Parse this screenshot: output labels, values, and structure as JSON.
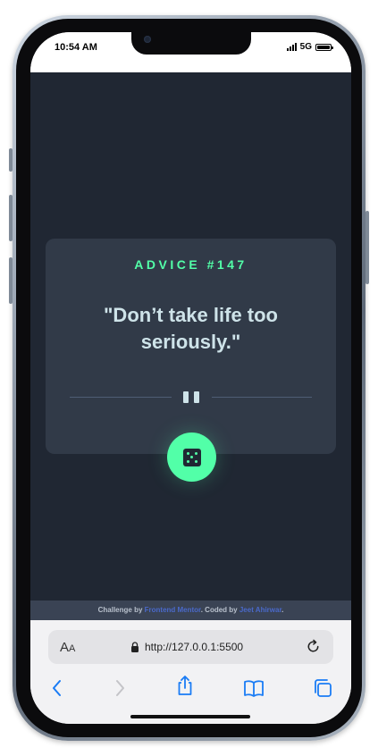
{
  "status_bar": {
    "time": "10:54 AM",
    "network": "5G"
  },
  "advice": {
    "id_label": "ADVICE #147",
    "quote": "\"Don’t take life too seriously.\""
  },
  "attribution": {
    "prefix": "Challenge by ",
    "challenge_link": "Frontend Mentor",
    "middle": ". Coded by ",
    "author_link": "Jeet Ahirwar",
    "suffix": "."
  },
  "browser": {
    "text_size_label": "A",
    "text_size_label_small": "A",
    "url": "http://127.0.0.1:5500"
  },
  "colors": {
    "accent_green": "#52ffa8",
    "app_background": "#202733",
    "card_background": "#313a48",
    "quote_text": "#cee3e9",
    "link_blue": "#4a69c9",
    "browser_blue": "#1a7cf5"
  },
  "icons": [
    "pause-divider-icon",
    "dice-icon",
    "lock-icon",
    "reload-icon",
    "back-icon",
    "forward-icon",
    "share-icon",
    "bookmarks-icon",
    "tabs-icon"
  ]
}
